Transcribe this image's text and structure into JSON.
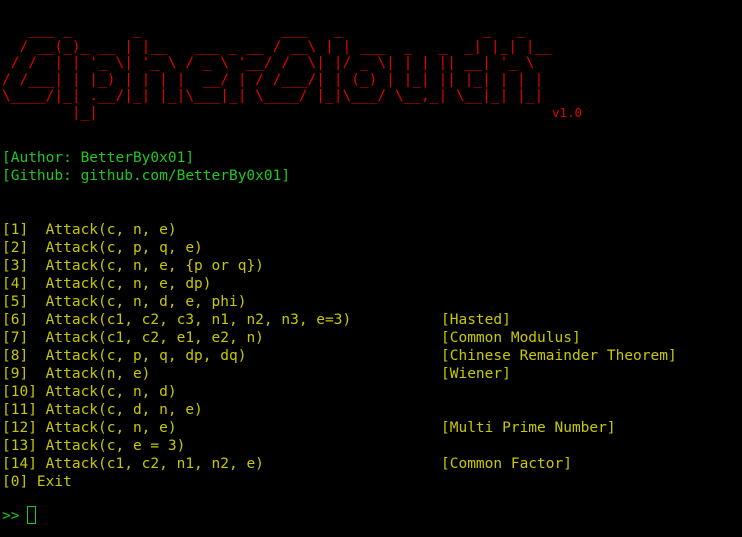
{
  "banner": {
    "art": "   ___ _       _                ___   _                _   _     \n  / __(_)_ __ | |__   ___ _ __ / __\\ | | ___  _   _  _| |_| |__  \n / /  | | '_ \\| '_ \\ / _ \\ '__/ /  \\| |/ _ \\| | | || __| '_ \\ \n/ /___| | |_) | | | |  __/ | / /___/| | (_) | |_| || |_| | | |\n\\____/|_| .__/|_| |_|\\___|_| \\____/ |_|\\___/ \\__,_| \\__|_| |_|\n        |_|                                                    ",
    "version": "v1.0"
  },
  "author": "[Author: BetterBy0x01]",
  "github": "[Github: github.com/BetterBy0x01]",
  "menu": [
    {
      "index": "[1] ",
      "call": "Attack(c, n, e)",
      "category": ""
    },
    {
      "index": "[2] ",
      "call": "Attack(c, p, q, e)",
      "category": ""
    },
    {
      "index": "[3] ",
      "call": "Attack(c, n, e, {p or q})",
      "category": ""
    },
    {
      "index": "[4] ",
      "call": "Attack(c, n, e, dp)",
      "category": ""
    },
    {
      "index": "[5] ",
      "call": "Attack(c, n, d, e, phi)",
      "category": ""
    },
    {
      "index": "[6] ",
      "call": "Attack(c1, c2, c3, n1, n2, n3, e=3)",
      "category": "[Hasted]"
    },
    {
      "index": "[7] ",
      "call": "Attack(c1, c2, e1, e2, n)",
      "category": "[Common Modulus]"
    },
    {
      "index": "[8] ",
      "call": "Attack(c, p, q, dp, dq)",
      "category": "[Chinese Remainder Theorem]"
    },
    {
      "index": "[9] ",
      "call": "Attack(n, e)",
      "category": "[Wiener]"
    },
    {
      "index": "[10]",
      "call": "Attack(c, n, d)",
      "category": ""
    },
    {
      "index": "[11]",
      "call": "Attack(c, d, n, e)",
      "category": ""
    },
    {
      "index": "[12]",
      "call": "Attack(c, n, e)",
      "category": "[Multi Prime Number]"
    },
    {
      "index": "[13]",
      "call": "Attack(c, e = 3)",
      "category": ""
    },
    {
      "index": "[14]",
      "call": "Attack(c1, c2, n1, n2, e)",
      "category": "[Common Factor]"
    }
  ],
  "exit": "[0] Exit",
  "prompt": ">>",
  "colors": {
    "background": "#000000",
    "banner": "#e00000",
    "info": "#1fc81f",
    "menu": "#c8c800",
    "prompt": "#1fc81f"
  }
}
